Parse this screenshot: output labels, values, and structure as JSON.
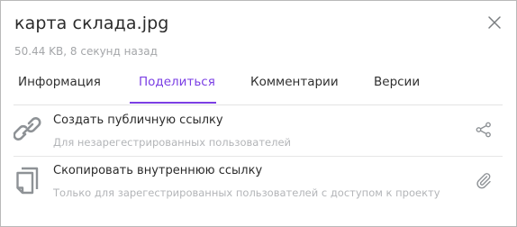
{
  "header": {
    "title": "карта склада.jpg",
    "subtitle": "50.44 KB, 8 секунд назад",
    "close_icon": "close-icon"
  },
  "tabs": [
    {
      "label": "Информация",
      "active": false
    },
    {
      "label": "Поделиться",
      "active": true
    },
    {
      "label": "Комментарии",
      "active": false
    },
    {
      "label": "Версии",
      "active": false
    }
  ],
  "share_options": [
    {
      "title": "Создать публичную ссылку",
      "description": "Для незарегестрированных пользователей",
      "icon": "link-icon",
      "action_icon": "share-icon"
    },
    {
      "title": "Скопировать внутреннюю ссылку",
      "description": "Только для зарегестрированных пользователей с доступом к проекту",
      "icon": "copy-icon",
      "action_icon": "paperclip-icon"
    }
  ],
  "colors": {
    "accent": "#7b3fe4",
    "text": "#2b2b2b",
    "muted": "#a4a6a9",
    "icon": "#8e9296"
  }
}
